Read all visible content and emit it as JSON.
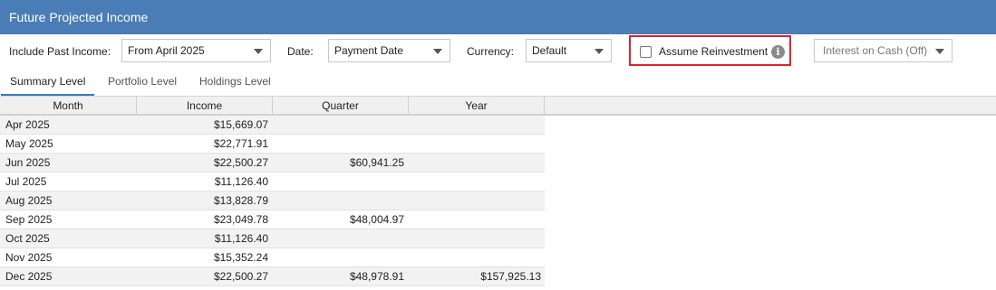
{
  "window": {
    "title": "Future Projected Income"
  },
  "toolbar": {
    "include_past_label": "Include Past Income:",
    "include_past_value": "From April 2025",
    "date_label": "Date:",
    "date_value": "Payment Date",
    "currency_label": "Currency:",
    "currency_value": "Default",
    "reinvest_label": "Assume Reinvestment",
    "reinvest_checked": false,
    "info_glyph": "i",
    "interest_value": "Interest on Cash (Off)"
  },
  "tabs": [
    {
      "label": "Summary Level",
      "active": true
    },
    {
      "label": "Portfolio Level",
      "active": false
    },
    {
      "label": "Holdings Level",
      "active": false
    }
  ],
  "table": {
    "columns": [
      "Month",
      "Income",
      "Quarter",
      "Year"
    ],
    "rows": [
      {
        "month": "Apr 2025",
        "income": "$15,669.07",
        "quarter": "",
        "year": ""
      },
      {
        "month": "May 2025",
        "income": "$22,771.91",
        "quarter": "",
        "year": ""
      },
      {
        "month": "Jun 2025",
        "income": "$22,500.27",
        "quarter": "$60,941.25",
        "year": ""
      },
      {
        "month": "Jul 2025",
        "income": "$11,126.40",
        "quarter": "",
        "year": ""
      },
      {
        "month": "Aug 2025",
        "income": "$13,828.79",
        "quarter": "",
        "year": ""
      },
      {
        "month": "Sep 2025",
        "income": "$23,049.78",
        "quarter": "$48,004.97",
        "year": ""
      },
      {
        "month": "Oct 2025",
        "income": "$11,126.40",
        "quarter": "",
        "year": ""
      },
      {
        "month": "Nov 2025",
        "income": "$15,352.24",
        "quarter": "",
        "year": ""
      },
      {
        "month": "Dec 2025",
        "income": "$22,500.27",
        "quarter": "$48,978.91",
        "year": "$157,925.13"
      }
    ]
  },
  "colors": {
    "title_bar": "#4a7db5",
    "highlight_border": "#d9262c",
    "active_tab_underline": "#3a78c2"
  }
}
